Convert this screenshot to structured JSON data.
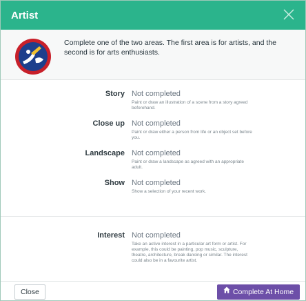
{
  "dialog": {
    "title": "Artist",
    "intro": "Complete one of the two areas. The first area is for artists, and the second is for arts enthusiasts."
  },
  "requirements": [
    {
      "label": "Story",
      "status": "Not completed",
      "description": "Paint or draw an illustration of a scene from a story agreed beforehand."
    },
    {
      "label": "Close up",
      "status": "Not completed",
      "description": "Paint or draw either a person from life or an object set before you."
    },
    {
      "label": "Landscape",
      "status": "Not completed",
      "description": "Paint or draw a landscape as agreed with an appropriate adult."
    },
    {
      "label": "Show",
      "status": "Not completed",
      "description": "Show a selection of your recent work."
    },
    {
      "label": "Interest",
      "status": "Not completed",
      "description": "Take an active interest in a particular art form or artist. For example, this could be painting, pop music, sculpture, theatre, architecture, break dancing or similar. The interest could also be in a favourite artist."
    }
  ],
  "footer": {
    "close_label": "Close",
    "complete_label": "Complete At Home"
  },
  "colors": {
    "header": "#2bb48c",
    "complete_button": "#6d4fa8",
    "badge_blue": "#1d3f8c",
    "badge_red": "#c8202a"
  },
  "icons": {
    "close": "close-icon",
    "badge": "artist-badge-icon",
    "home": "home-icon"
  }
}
